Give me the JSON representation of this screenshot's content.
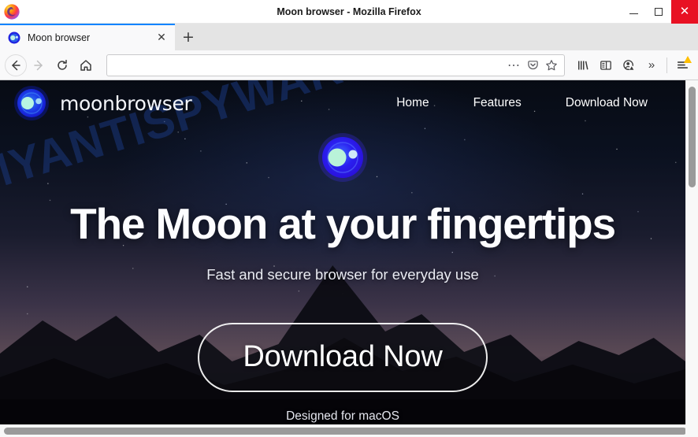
{
  "window": {
    "title": "Moon browser - Mozilla Firefox",
    "app_icon": "firefox-logo-icon",
    "controls": {
      "minimize_label": "—",
      "maximize_label": "□",
      "close_label": "✕"
    },
    "close_color": "#e81123"
  },
  "tabs": [
    {
      "title": "Moon browser",
      "favicon": "moonbrowser-favicon-icon",
      "close_label": "✕",
      "active": true
    }
  ],
  "newtab_label": "+",
  "toolbar": {
    "back_label": "←",
    "forward_label": "→",
    "reload_label": "↻",
    "home_label": "⌂",
    "url_value": "",
    "url_placeholder": "",
    "page_actions_label": "⋯",
    "pocket_label": "pocket-icon",
    "bookmark_label": "☆",
    "library_label": "library-icon",
    "sidebar_label": "sidebar-icon",
    "account_label": "account-warning-icon",
    "overflow_label": "»",
    "menu_label": "hamburger-menu-icon",
    "menu_badge": "update-warning-badge"
  },
  "page": {
    "watermark": "MYANTISPYWARE.COM",
    "brand": {
      "name": "moonbrowser",
      "logo": "moonbrowser-logo-icon"
    },
    "nav": [
      {
        "label": "Home"
      },
      {
        "label": "Features"
      },
      {
        "label": "Download Now"
      }
    ],
    "hero": {
      "logo": "moonbrowser-hero-logo-icon",
      "title": "The Moon at your fingertips",
      "subtitle": "Fast and secure browser for everyday use",
      "cta_label": "Download Now",
      "note": "Designed for macOS"
    },
    "colors": {
      "logo_outer": "#1a1ae8",
      "logo_mid": "#2f6fe8",
      "logo_dot": "#a8f0d8",
      "sky_top": "#070b14",
      "sky_mid": "#1a1c2e",
      "sky_bottom": "#5b4a55",
      "watermark": "#1a3a82",
      "text": "#ffffff"
    }
  }
}
